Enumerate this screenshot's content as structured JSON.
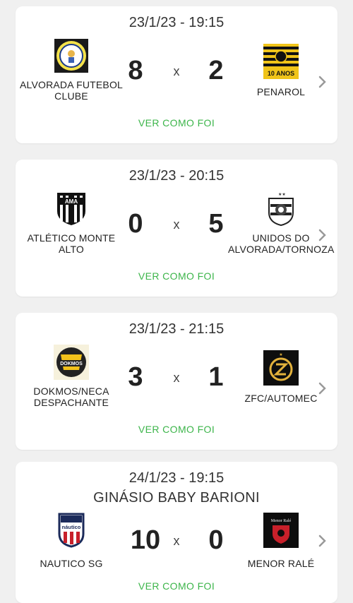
{
  "action_label": "VER COMO FOI",
  "separator": "x",
  "colors": {
    "background": "#f0f0f0",
    "card": "#ffffff",
    "accent": "#3cb54a"
  },
  "matches": [
    {
      "date": "23/1/23 - 19:15",
      "home": {
        "name": "ALVORADA FUTEBOL CLUBE",
        "score": "8",
        "logo": "alvorada-logo"
      },
      "away": {
        "name": "PENAROL",
        "score": "2",
        "logo": "penarol-flag-logo",
        "logo_text": "10 ANOS"
      }
    },
    {
      "date": "23/1/23 - 20:15",
      "home": {
        "name": "ATLÉTICO MONTE ALTO",
        "score": "0",
        "logo": "atletico-shield-logo",
        "logo_text": "AMA"
      },
      "away": {
        "name": "UNIDOS DO ALVORADA/TORNOZA",
        "score": "5",
        "logo": "unidos-lion-logo"
      }
    },
    {
      "date": "23/1/23 - 21:15",
      "home": {
        "name": "DOKMOS/NECA DESPACHANTE",
        "score": "3",
        "logo": "dokmos-logo",
        "logo_text": "DOKMOS"
      },
      "away": {
        "name": "ZFC/AUTOMEC",
        "score": "1",
        "logo": "zfc-logo"
      }
    },
    {
      "date": "24/1/23 - 19:15",
      "venue": "GINÁSIO BABY BARIONI",
      "home": {
        "name": "NAUTICO SG",
        "score": "10",
        "logo": "nautico-shield-logo",
        "logo_text": "náutico"
      },
      "away": {
        "name": "MENOR RALÉ",
        "score": "0",
        "logo": "menor-rale-logo",
        "logo_text": "Menor Ralé"
      }
    }
  ]
}
